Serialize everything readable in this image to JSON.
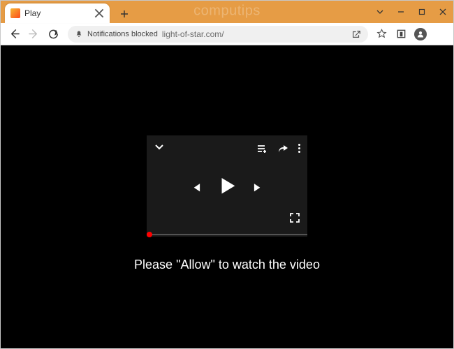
{
  "window": {
    "watermark": "computips"
  },
  "tab": {
    "title": "Play"
  },
  "addressbar": {
    "notification_status": "Notifications blocked",
    "url": "light-of-star.com/"
  },
  "page": {
    "instruction": "Please \"Allow\" to watch the video"
  }
}
